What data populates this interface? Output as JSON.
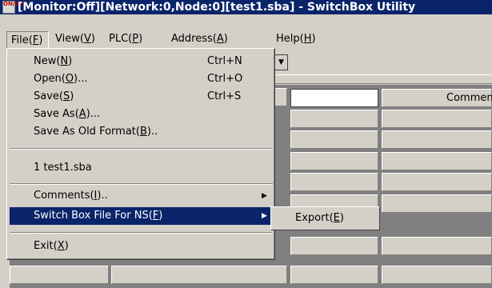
{
  "title": {
    "icon_text": "ON/OFF",
    "text": "[Monitor:Off][Network:0,Node:0][test1.sba] - SwitchBox Utility"
  },
  "menubar": {
    "items": [
      {
        "label": "File",
        "key": "F"
      },
      {
        "label": "View",
        "key": "V"
      },
      {
        "label": "PLC",
        "key": "P"
      },
      {
        "label": "Address",
        "key": "A"
      },
      {
        "label": "Help",
        "key": "H"
      }
    ]
  },
  "file_menu": {
    "items": [
      {
        "label": "New",
        "key": "N",
        "shortcut": "Ctrl+N"
      },
      {
        "label": "Open",
        "key": "O",
        "suffix": "...",
        "shortcut": "Ctrl+O"
      },
      {
        "label": "Save",
        "key": "S",
        "shortcut": "Ctrl+S"
      },
      {
        "label": "Save As",
        "key": "A",
        "suffix": "..."
      },
      {
        "label": "Save As Old Format",
        "key": "B",
        "suffix": ".."
      },
      {
        "label": "1 test1.sba"
      },
      {
        "label": "Comments",
        "key": "I",
        "suffix": "..",
        "submenu": true
      },
      {
        "label": "Switch Box File For NS",
        "key": "F",
        "submenu": true,
        "selected": true
      },
      {
        "label": "Exit",
        "key": "X"
      }
    ]
  },
  "submenu": {
    "items": [
      {
        "label": "Export",
        "key": "E"
      }
    ]
  },
  "grid": {
    "comment_header": "Comment"
  },
  "colors": {
    "titlebar": "#0a246a",
    "menu_bg": "#d4d0c8",
    "highlight": "#0a246a"
  }
}
